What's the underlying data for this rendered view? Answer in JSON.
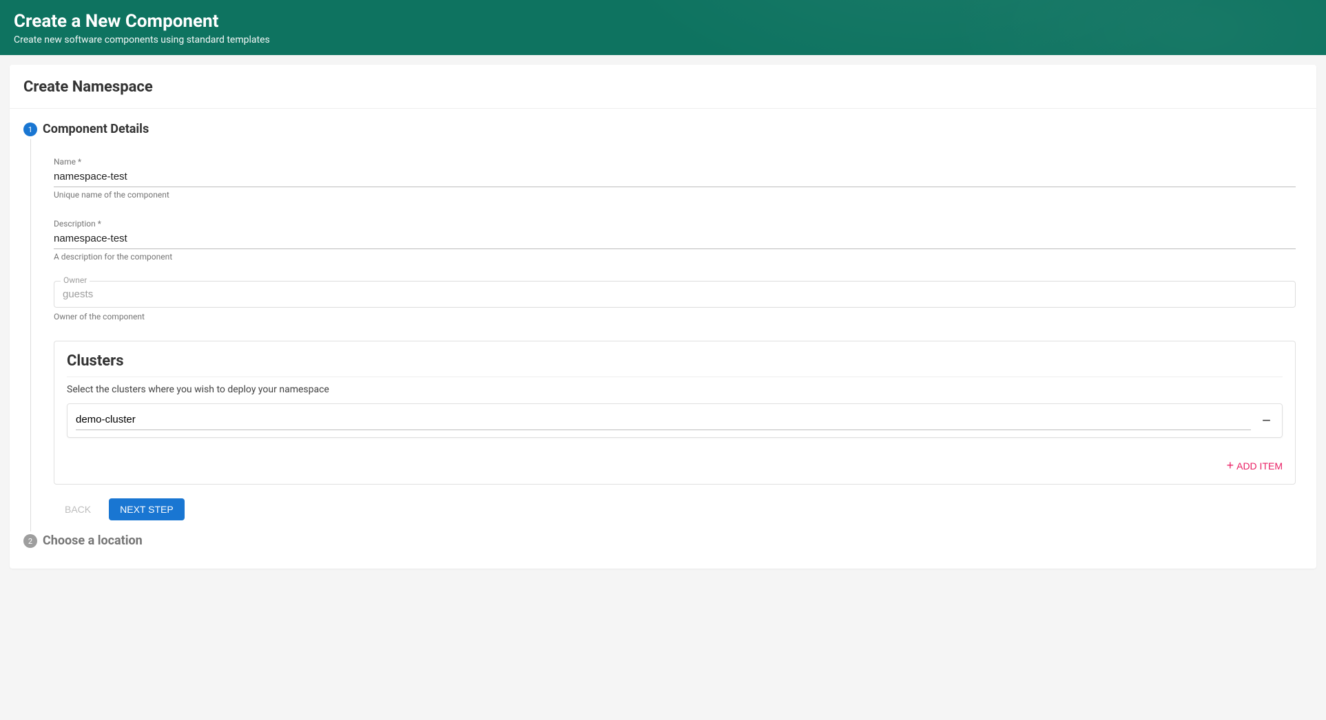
{
  "header": {
    "title": "Create a New Component",
    "subtitle": "Create new software components using standard templates"
  },
  "card": {
    "title": "Create Namespace"
  },
  "steps": [
    {
      "number": "1",
      "label": "Component Details",
      "active": true
    },
    {
      "number": "2",
      "label": "Choose a location",
      "active": false
    }
  ],
  "form": {
    "name": {
      "label": "Name *",
      "value": "namespace-test",
      "help": "Unique name of the component"
    },
    "description": {
      "label": "Description *",
      "value": "namespace-test",
      "help": "A description for the component"
    },
    "owner": {
      "label": "Owner",
      "placeholder": "guests",
      "value": "",
      "help": "Owner of the component"
    },
    "clusters": {
      "title": "Clusters",
      "description": "Select the clusters where you wish to deploy your namespace",
      "items": [
        {
          "value": "demo-cluster"
        }
      ],
      "add_label": "ADD ITEM"
    }
  },
  "buttons": {
    "back": "BACK",
    "next": "NEXT STEP"
  }
}
